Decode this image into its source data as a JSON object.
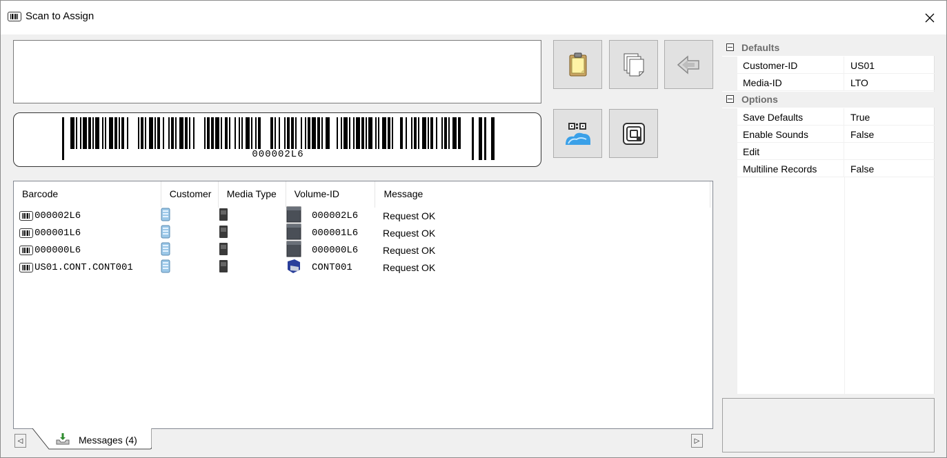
{
  "window": {
    "title": "Scan to Assign",
    "title_icon": "barcode-icon",
    "close_label": "✕"
  },
  "scan": {
    "input_value": "",
    "barcode_text": "000002L6"
  },
  "toolbar": [
    {
      "name": "paste-button",
      "icon": "clipboard-icon"
    },
    {
      "name": "copy-button",
      "icon": "pages-icon"
    },
    {
      "name": "back-button",
      "icon": "arrow-left-icon"
    },
    {
      "name": "qr-cloud-button",
      "icon": "qr-cloud-icon"
    },
    {
      "name": "rfid-button",
      "icon": "rfid-icon"
    }
  ],
  "grid": {
    "columns": [
      "Barcode",
      "Customer",
      "Media Type",
      "Volume-ID",
      "Message"
    ],
    "rows": [
      {
        "barcode": "000002L6",
        "volume_id": "000002L6",
        "volume_icon": "tape-icon",
        "message": "Request OK"
      },
      {
        "barcode": "000001L6",
        "volume_id": "000001L6",
        "volume_icon": "tape-icon",
        "message": "Request OK"
      },
      {
        "barcode": "000000L6",
        "volume_id": "000000L6",
        "volume_icon": "tape-icon",
        "message": "Request OK"
      },
      {
        "barcode": "US01.CONT.CONT001",
        "volume_id": "CONT001",
        "volume_icon": "container-icon",
        "message": "Request OK"
      }
    ]
  },
  "tabs": {
    "messages_label": "Messages (4)",
    "scroll_left": "◁",
    "scroll_right": "▷"
  },
  "properties": {
    "categories": [
      {
        "label": "Defaults",
        "items": [
          {
            "name": "Customer-ID",
            "value": "US01"
          },
          {
            "name": "Media-ID",
            "value": "LTO"
          }
        ]
      },
      {
        "label": "Options",
        "items": [
          {
            "name": "Save Defaults",
            "value": "True"
          },
          {
            "name": "Enable Sounds",
            "value": "False"
          },
          {
            "name": "Edit",
            "value": ""
          },
          {
            "name": "Multiline Records",
            "value": "False"
          }
        ]
      }
    ]
  }
}
